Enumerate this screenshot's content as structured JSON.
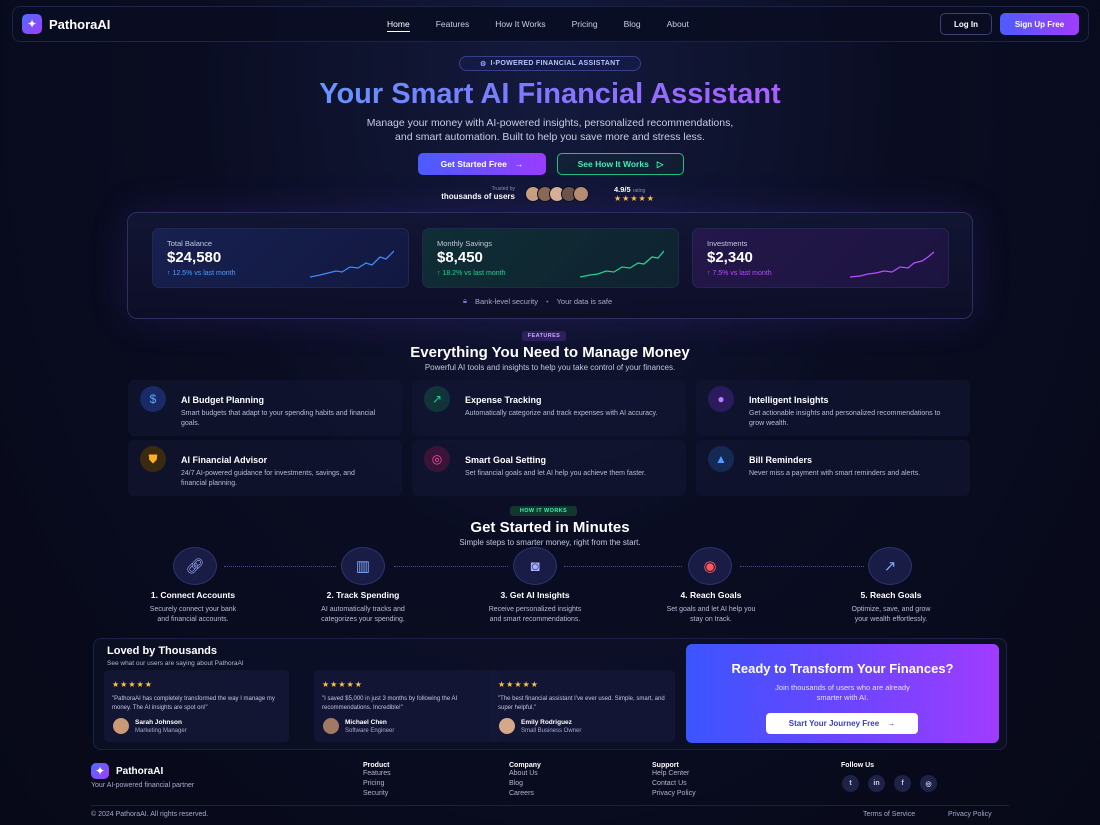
{
  "brand": {
    "name": "PathoraAI",
    "tagline": "Your AI-powered financial partner"
  },
  "nav": {
    "links": [
      "Home",
      "Features",
      "How It Works",
      "Pricing",
      "Blog",
      "About"
    ],
    "login": "Log In",
    "signup": "Sign Up Free"
  },
  "hero": {
    "pill": "I-POWERED FINANCIAL ASSISTANT",
    "title": "Your Smart AI Financial Assistant",
    "subtitle_line1": "Manage your money with AI-powered insights, personalized recommendations,",
    "subtitle_line2": "and smart automation. Built to help you save more and stress less.",
    "cta_primary": "Get Started Free",
    "cta_secondary": "See How It Works",
    "trust_small": "Trusted by",
    "trust_main": "thousands of users",
    "rating": "4.9/5",
    "rating_suffix": "rating"
  },
  "dashboard": {
    "cards": [
      {
        "label": "Total Balance",
        "value": "$24,580",
        "change": "12.5% vs last month",
        "color": "#3d8bff"
      },
      {
        "label": "Monthly Savings",
        "value": "$8,450",
        "change": "18.2% vs last month",
        "color": "#1fd38e"
      },
      {
        "label": "Investments",
        "value": "$2,340",
        "change": "7.5% vs last month",
        "color": "#b44dff"
      }
    ],
    "security": "Bank-level security",
    "safe": "Your data is safe"
  },
  "features": {
    "tag": "FEATURES",
    "title": "Everything You Need to Manage Money",
    "subtitle": "Powerful AI tools and insights to help you take control of your finances.",
    "items": [
      {
        "title": "AI Budget Planning",
        "desc": "Smart budgets that adapt to your spending habits and financial goals.",
        "icon": "dollar-icon"
      },
      {
        "title": "Expense Tracking",
        "desc": "Automatically categorize and track expenses with AI accuracy.",
        "icon": "trend-icon"
      },
      {
        "title": "Intelligent Insights",
        "desc": "Get actionable insights and personalized recommendations to grow wealth.",
        "icon": "lightbulb-icon"
      },
      {
        "title": "AI Financial Advisor",
        "desc": "24/7 AI-powered guidance for investments, savings, and financial planning.",
        "icon": "shield-icon"
      },
      {
        "title": "Smart Goal Setting",
        "desc": "Set financial goals and let AI help you achieve them faster.",
        "icon": "target-icon"
      },
      {
        "title": "Bill Reminders",
        "desc": "Never miss a payment with smart reminders and alerts.",
        "icon": "bell-icon"
      }
    ]
  },
  "how": {
    "tag": "HOW IT WORKS",
    "title": "Get Started in Minutes",
    "subtitle": "Simple steps to smarter money, right from the start.",
    "steps": [
      {
        "title": "1. Connect Accounts",
        "l1": "Securely connect your bank",
        "l2": "and financial accounts.",
        "icon": "link-icon"
      },
      {
        "title": "2. Track Spending",
        "l1": "AI automatically tracks and",
        "l2": "categorizes your spending.",
        "icon": "bar-chart-icon"
      },
      {
        "title": "3. Get AI Insights",
        "l1": "Receive personalized insights",
        "l2": "and smart recommendations.",
        "icon": "robot-icon"
      },
      {
        "title": "4. Reach Goals",
        "l1": "Set goals and let AI help you",
        "l2": "stay on track.",
        "icon": "target-icon"
      },
      {
        "title": "5. Reach Goals",
        "l1": "Optimize, save, and grow",
        "l2": "your wealth effortlessly.",
        "icon": "growth-icon"
      }
    ]
  },
  "testimonials": {
    "title": "Loved by Thousands",
    "subtitle": "See what our users are saying about PathoraAI",
    "items": [
      {
        "quote": "\"PathoraAI has completely transformed the way I manage my money. The AI insights are spot on!\"",
        "name": "Sarah Johnson",
        "role": "Marketing Manager",
        "stars": "★★★★★"
      },
      {
        "quote": "\"I saved $5,000 in just 3 months by following the AI recommendations. Incredible!\"",
        "name": "Michael Chen",
        "role": "Software Engineer",
        "stars": "★★★★★"
      },
      {
        "quote": "\"The best financial assistant I've ever used. Simple, smart, and super helpful.\"",
        "name": "Emily Rodriguez",
        "role": "Small Business Owner",
        "stars": "★★★★★"
      }
    ]
  },
  "cta": {
    "title": "Ready to Transform Your Finances?",
    "line1": "Join thousands of users who are already",
    "line2": "smarter with AI.",
    "button": "Start Your Journey Free"
  },
  "footer": {
    "columns": [
      {
        "heading": "Product",
        "items": [
          "Features",
          "Pricing",
          "Security"
        ]
      },
      {
        "heading": "Company",
        "items": [
          "About Us",
          "Blog",
          "Careers"
        ]
      },
      {
        "heading": "Support",
        "items": [
          "Help Center",
          "Contact Us",
          "Privacy Policy"
        ]
      }
    ],
    "follow": "Follow Us",
    "social": [
      "twitter-icon",
      "linkedin-icon",
      "facebook-icon",
      "instagram-icon"
    ],
    "copyright": "© 2024 PathoraAI. All rights reserved.",
    "terms": "Terms of Service",
    "privacy": "Privacy Policy"
  }
}
